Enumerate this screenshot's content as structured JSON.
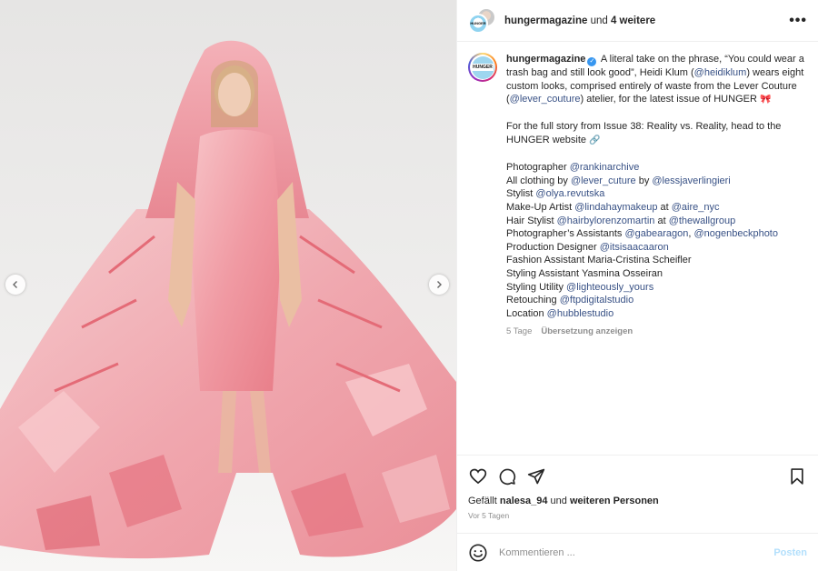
{
  "header": {
    "username": "hungermagazine",
    "joiner": " und ",
    "others": "4 weitere",
    "more_icon": "more-horizontal-icon"
  },
  "avatar_label": "HUNGER",
  "caption": {
    "username": "hungermagazine",
    "p1_a": " A literal take on the phrase, “You could wear a trash bag and still look good”, Heidi Klum (",
    "p1_m1": "@heidiklum",
    "p1_b": ") wears eight custom looks, comprised entirely of waste from the Lever Couture (",
    "p1_m2": "@lever_couture",
    "p1_c": ") atelier, for the latest issue of HUNGER ",
    "p1_emoji": "🎀",
    "p2": "For the full story from Issue 38: Reality vs. Reality, head to the HUNGER website ",
    "p2_emoji": "🔗",
    "credits": [
      {
        "parts": [
          {
            "t": "Photographer "
          },
          {
            "m": "@rankinarchive"
          }
        ]
      },
      {
        "parts": [
          {
            "t": "All clothing by "
          },
          {
            "m": "@lever_cuture"
          },
          {
            "t": " by "
          },
          {
            "m": "@lessjaverlingieri"
          }
        ]
      },
      {
        "parts": [
          {
            "t": "Stylist "
          },
          {
            "m": "@olya.revutska"
          }
        ]
      },
      {
        "parts": [
          {
            "t": "Make-Up Artist "
          },
          {
            "m": "@lindahaymakeup"
          },
          {
            "t": " at "
          },
          {
            "m": "@aire_nyc"
          }
        ]
      },
      {
        "parts": [
          {
            "t": "Hair Stylist "
          },
          {
            "m": "@hairbylorenzomartin"
          },
          {
            "t": " at "
          },
          {
            "m": "@thewallgroup"
          }
        ]
      },
      {
        "parts": [
          {
            "t": "Photographer’s Assistants "
          },
          {
            "m": "@gabearagon"
          },
          {
            "t": ", "
          },
          {
            "m": "@nogenbeckphoto"
          }
        ]
      },
      {
        "parts": [
          {
            "t": "Production Designer "
          },
          {
            "m": "@itsisaacaaron"
          }
        ]
      },
      {
        "parts": [
          {
            "t": "Fashion Assistant Maria-Cristina Scheifler"
          }
        ]
      },
      {
        "parts": [
          {
            "t": "Styling Assistant Yasmina Osseiran"
          }
        ]
      },
      {
        "parts": [
          {
            "t": "Styling Utility "
          },
          {
            "m": "@lighteously_yours"
          }
        ]
      },
      {
        "parts": [
          {
            "t": "Retouching "
          },
          {
            "m": "@ftpdigitalstudio"
          }
        ]
      },
      {
        "parts": [
          {
            "t": "Location "
          },
          {
            "m": "@hubblestudio"
          }
        ]
      }
    ],
    "age": "5 Tage",
    "translate": "Übersetzung anzeigen"
  },
  "likes": {
    "prefix": "Gefällt ",
    "user": "nalesa_94",
    "middle": " und ",
    "suffix": "weiteren Personen"
  },
  "timestamp": "Vor 5 Tagen",
  "comment": {
    "placeholder": "Kommentieren ...",
    "post_label": "Posten"
  },
  "colors": {
    "mention": "#385185",
    "post_button": "#b2dffc",
    "verified": "#3897f0",
    "dress_pink": "#f2a3ac"
  }
}
